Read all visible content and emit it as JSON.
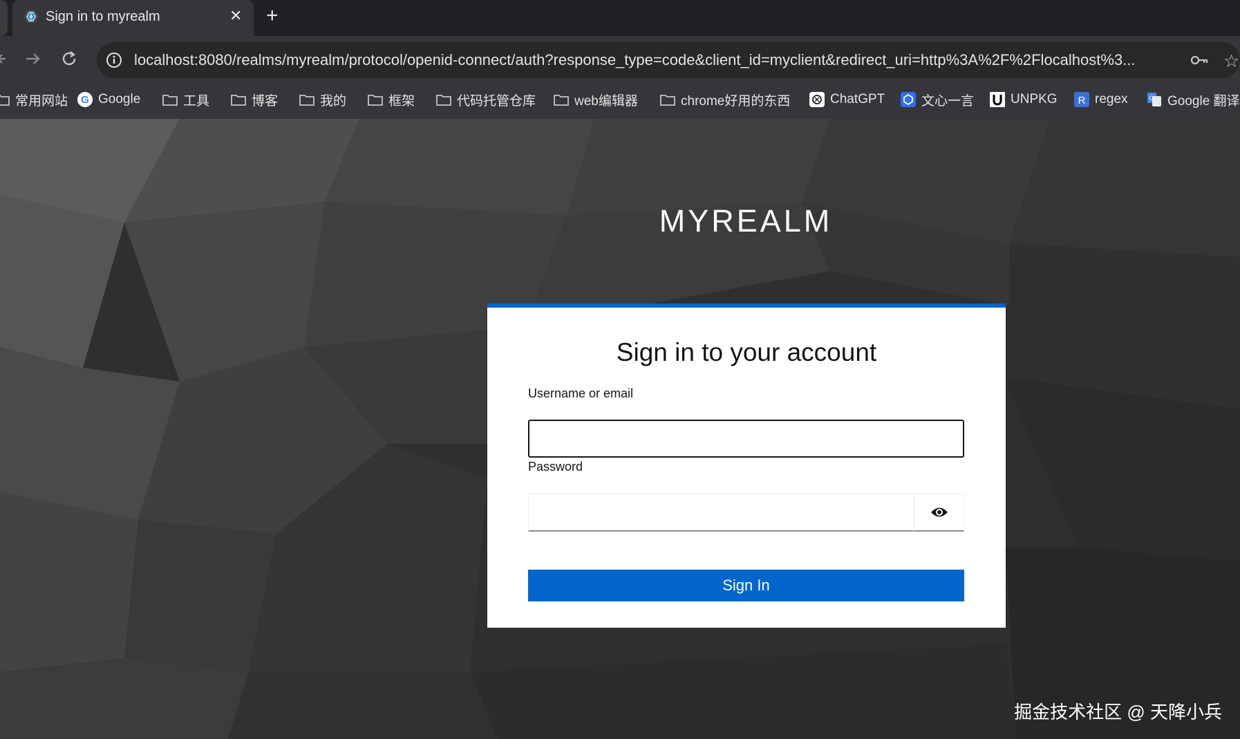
{
  "browser": {
    "tab_title": "Sign in to myrealm",
    "new_tab_label": "+",
    "close_label": "✕",
    "url": "localhost:8080/realms/myrealm/protocol/openid-connect/auth?response_type=code&client_id=myclient&redirect_uri=http%3A%2F%2Flocalhost%3...",
    "bookmarks": [
      {
        "label": "常用网站",
        "icon": "folder-icon"
      },
      {
        "label": "Google",
        "icon": "google-icon"
      },
      {
        "label": "工具",
        "icon": "folder-icon"
      },
      {
        "label": "博客",
        "icon": "folder-icon"
      },
      {
        "label": "我的",
        "icon": "folder-icon"
      },
      {
        "label": "框架",
        "icon": "folder-icon"
      },
      {
        "label": "代码托管仓库",
        "icon": "folder-icon"
      },
      {
        "label": "web编辑器",
        "icon": "folder-icon"
      },
      {
        "label": "chrome好用的东西",
        "icon": "folder-icon"
      },
      {
        "label": "ChatGPT",
        "icon": "chatgpt-icon"
      },
      {
        "label": "文心一言",
        "icon": "wenxin-icon"
      },
      {
        "label": "UNPKG",
        "icon": "unpkg-icon"
      },
      {
        "label": "regex",
        "icon": "regex-icon"
      },
      {
        "label": "Google 翻译",
        "icon": "google-translate-icon"
      }
    ]
  },
  "page": {
    "realm_title": "MYREALM",
    "heading": "Sign in to your account",
    "username_label": "Username or email",
    "username_value": "",
    "password_label": "Password",
    "password_value": "",
    "signin_label": "Sign In",
    "watermark": "掘金技术社区 @ 天降小兵"
  },
  "colors": {
    "accent": "#0066cc",
    "tab_bg": "#35363a",
    "tabstrip_bg": "#202124"
  }
}
